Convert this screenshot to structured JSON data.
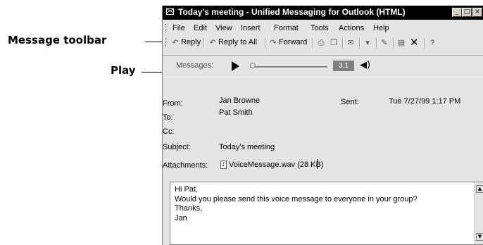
{
  "callouts": {
    "toolbar_label": "Message toolbar",
    "play_label": "Play"
  },
  "window": {
    "title": "Today's meeting - Unified Messaging for Outlook (HTML)",
    "minimize": "_",
    "maximize": "□",
    "close": "×"
  },
  "menu": {
    "items": [
      "File",
      "Edit",
      "View",
      "Insert",
      "Format",
      "Tools",
      "Actions",
      "Help"
    ]
  },
  "toolbar": {
    "reply": "Reply",
    "reply_all": "Reply to All",
    "forward": "Forward",
    "icons": [
      "reply-icon",
      "reply-all-icon",
      "forward-icon",
      "print-icon",
      "copy-icon",
      "move-icon",
      "flag-icon",
      "compose-icon",
      "address-book-icon",
      "delete-icon",
      "help-icon"
    ]
  },
  "player": {
    "label": "Messages:",
    "time": "3.1"
  },
  "header": {
    "from_label": "From:",
    "from_value": "Jan Browne",
    "sent_label": "Sent:",
    "sent_value": "Tue 7/27/99 1:17 PM",
    "to_label": "To:",
    "to_value": "Pat Smith",
    "cc_label": "Cc:",
    "subject_label": "Subject:",
    "subject_value": "Today's meeting",
    "attachments_label": "Attachments:",
    "attachment_value": "VoiceMessage.wav (28 KB)"
  },
  "message": {
    "lines": [
      "Hi Pat,",
      "Would you please send this voice message to everyone in your group?",
      "Thanks,",
      "Jan"
    ]
  }
}
